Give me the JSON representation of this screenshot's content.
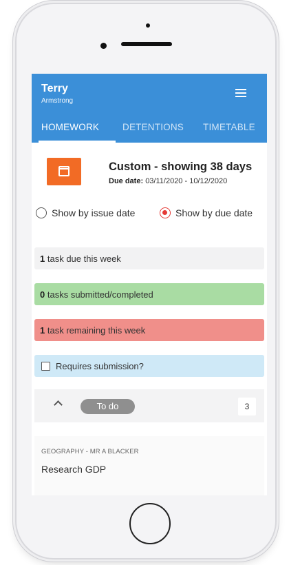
{
  "header": {
    "user_first_name": "Terry",
    "user_last_name": "Armstrong",
    "accent_color": "#3b8fd8"
  },
  "tabs": [
    {
      "label": "HOMEWORK",
      "active": true
    },
    {
      "label": "DETENTIONS",
      "active": false
    },
    {
      "label": "TIMETABLE",
      "active": false
    }
  ],
  "filter": {
    "title": "Custom - showing 38 days",
    "due_label": "Due date:",
    "due_range": "03/11/2020 - 10/12/2020",
    "button_color": "#f26b25"
  },
  "radios": {
    "issue_label": "Show by issue date",
    "due_label": "Show by due date",
    "selected": "due"
  },
  "stats": {
    "due_count": "1",
    "due_text": "task due this week",
    "submitted_count": "0",
    "submitted_text": "tasks submitted/completed",
    "remaining_count": "1",
    "remaining_text": "task remaining this week",
    "requires_submission_label": "Requires submission?"
  },
  "todo": {
    "label": "To do",
    "count": "3"
  },
  "task": {
    "subject": "GEOGRAPHY - MR A BLACKER",
    "title": "Research GDP"
  }
}
